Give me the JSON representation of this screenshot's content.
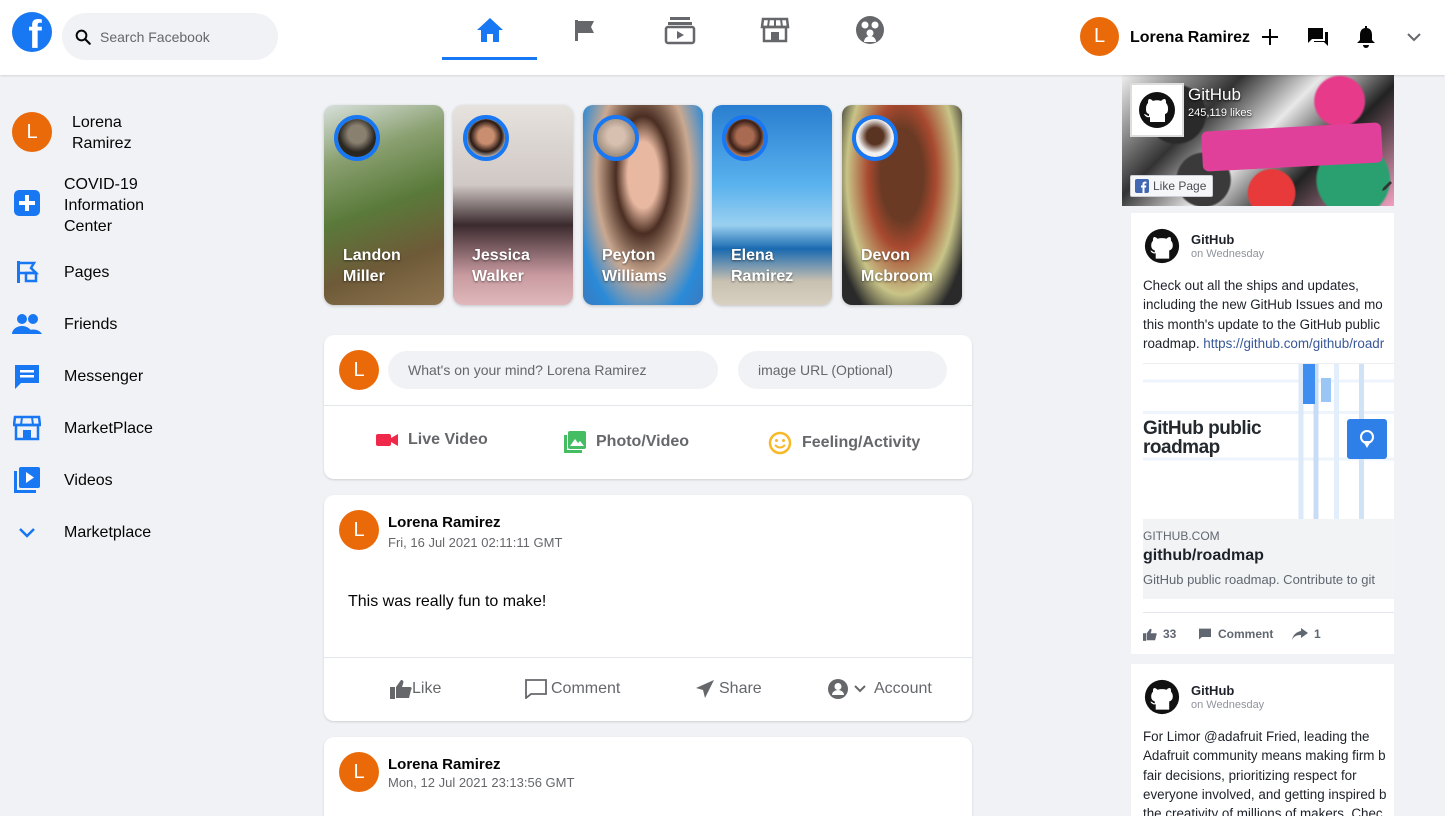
{
  "header": {
    "search_placeholder": "Search Facebook",
    "user_initial": "L",
    "user_name": "Lorena Ramirez",
    "nav": [
      "home-icon",
      "flag-icon",
      "watch-icon",
      "marketplace-icon",
      "groups-icon"
    ],
    "active_color": "#1877f2",
    "avatar_color": "#ea6a0a"
  },
  "sidebar": {
    "profile": {
      "initial": "L",
      "name": "Lorena Ramirez"
    },
    "items": [
      {
        "label": "COVID-19 Information Center",
        "icon": "covid-plus-icon"
      },
      {
        "label": "Pages",
        "icon": "flag-icon"
      },
      {
        "label": "Friends",
        "icon": "friends-icon"
      },
      {
        "label": "Messenger",
        "icon": "messenger-icon"
      },
      {
        "label": "MarketPlace",
        "icon": "store-icon"
      },
      {
        "label": "Videos",
        "icon": "video-icon"
      },
      {
        "label": "Marketplace",
        "icon": "chevron-down-icon"
      }
    ]
  },
  "stories": [
    {
      "name": "Landon Miller"
    },
    {
      "name": "Jessica Walker"
    },
    {
      "name": "Peyton Williams"
    },
    {
      "name": "Elena Ramirez"
    },
    {
      "name": "Devon Mcbroom"
    }
  ],
  "composer": {
    "initial": "L",
    "status_placeholder": "What's on your mind? Lorena Ramirez",
    "image_placeholder": "image URL (Optional)",
    "actions": [
      {
        "label": "Live Video",
        "icon": "live-video-icon",
        "color": "#f02849"
      },
      {
        "label": "Photo/Video",
        "icon": "photo-icon",
        "color": "#45bd62"
      },
      {
        "label": "Feeling/Activity",
        "icon": "smile-icon",
        "color": "#f7b928"
      }
    ]
  },
  "posts": [
    {
      "initial": "L",
      "author": "Lorena Ramirez",
      "timestamp": "Fri, 16 Jul 2021 02:11:11 GMT",
      "text": "This was really fun to make!",
      "actions": {
        "like": "Like",
        "comment": "Comment",
        "share": "Share",
        "account": "Account"
      }
    },
    {
      "initial": "L",
      "author": "Lorena Ramirez",
      "timestamp": "Mon, 12 Jul 2021 23:13:56 GMT"
    }
  ],
  "page_plugin": {
    "page_name": "GitHub",
    "likes": "245,119 likes",
    "like_page_label": "Like Page",
    "posts": [
      {
        "author": "GitHub",
        "when": "on Wednesday",
        "lines": [
          "Check out all the ships and updates,",
          "including the new GitHub Issues and mo",
          "this month's update to the GitHub public",
          "roadmap. "
        ],
        "link": "https://github.com/github/roadr",
        "image_text": "GitHub public roadmap",
        "domain": "GITHUB.COM",
        "link_title": "github/roadmap",
        "link_desc": "GitHub public roadmap. Contribute to git",
        "likes": "33",
        "comment_label": "Comment",
        "shares": "1"
      },
      {
        "author": "GitHub",
        "when": "on Wednesday",
        "lines": [
          "For Limor @adafruit Fried, leading the",
          "Adafruit community means making firm b",
          "fair decisions, prioritizing respect for",
          "everyone involved, and getting inspired b",
          "the creativity of millions of makers. Chec"
        ]
      }
    ]
  }
}
